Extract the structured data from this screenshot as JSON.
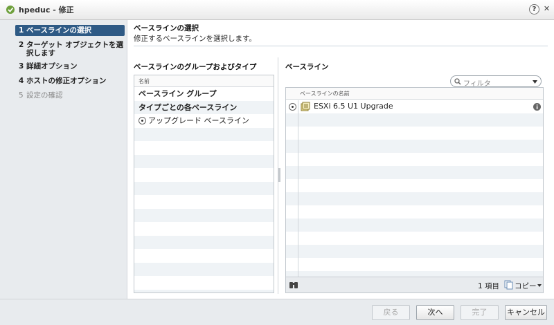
{
  "window": {
    "title": "hpeduc - 修正",
    "help": "?",
    "close": "✕"
  },
  "steps": [
    {
      "num": "1",
      "label": "ベースラインの選択"
    },
    {
      "num": "2",
      "label": "ターゲット オブジェクトを選択します"
    },
    {
      "num": "3",
      "label": "詳細オプション"
    },
    {
      "num": "4",
      "label": "ホストの修正オプション"
    },
    {
      "num": "5",
      "label": "設定の確認"
    }
  ],
  "page": {
    "title": "ベースラインの選択",
    "subtitle": "修正するベースラインを選択します。"
  },
  "groups": {
    "label": "ベースラインのグループおよびタイプ",
    "column": "名前",
    "rows": [
      "ベースライン グループ",
      "タイプごとの各ベースライン",
      "アップグレード ベースライン"
    ]
  },
  "baselines": {
    "label": "ベースライン",
    "filter_placeholder": "フィルタ",
    "column": "ベースラインの名前",
    "items": [
      {
        "name": "ESXi 6.5 U1 Upgrade"
      }
    ],
    "count": "1 項目",
    "copy": "コピー"
  },
  "buttons": {
    "back": "戻る",
    "next": "次へ",
    "finish": "完了",
    "cancel": "キャンセル"
  },
  "colors": {
    "active_step": "#2e5a85",
    "stripe": "#eff3f6",
    "panel_bg": "#e8ebee"
  }
}
